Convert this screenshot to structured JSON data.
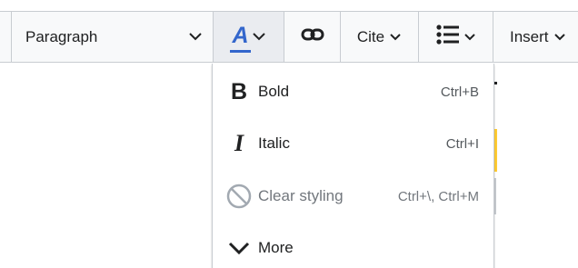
{
  "toolbar": {
    "paragraph_label": "Paragraph",
    "cite_label": "Cite",
    "insert_label": "Insert",
    "accent_color": "#3366cc"
  },
  "style_menu": {
    "items": [
      {
        "icon": "bold-icon",
        "icon_glyph": "B",
        "label": "Bold",
        "shortcut": "Ctrl+B",
        "disabled": false
      },
      {
        "icon": "italic-icon",
        "icon_glyph": "I",
        "label": "Italic",
        "shortcut": "Ctrl+I",
        "disabled": false
      },
      {
        "icon": "clear-styling-icon",
        "label": "Clear styling",
        "shortcut": "Ctrl+\\, Ctrl+M",
        "disabled": true
      },
      {
        "icon": "chevron-down-icon",
        "label": "More",
        "shortcut": "",
        "disabled": false
      }
    ]
  },
  "style_button": {
    "glyph": "A"
  }
}
